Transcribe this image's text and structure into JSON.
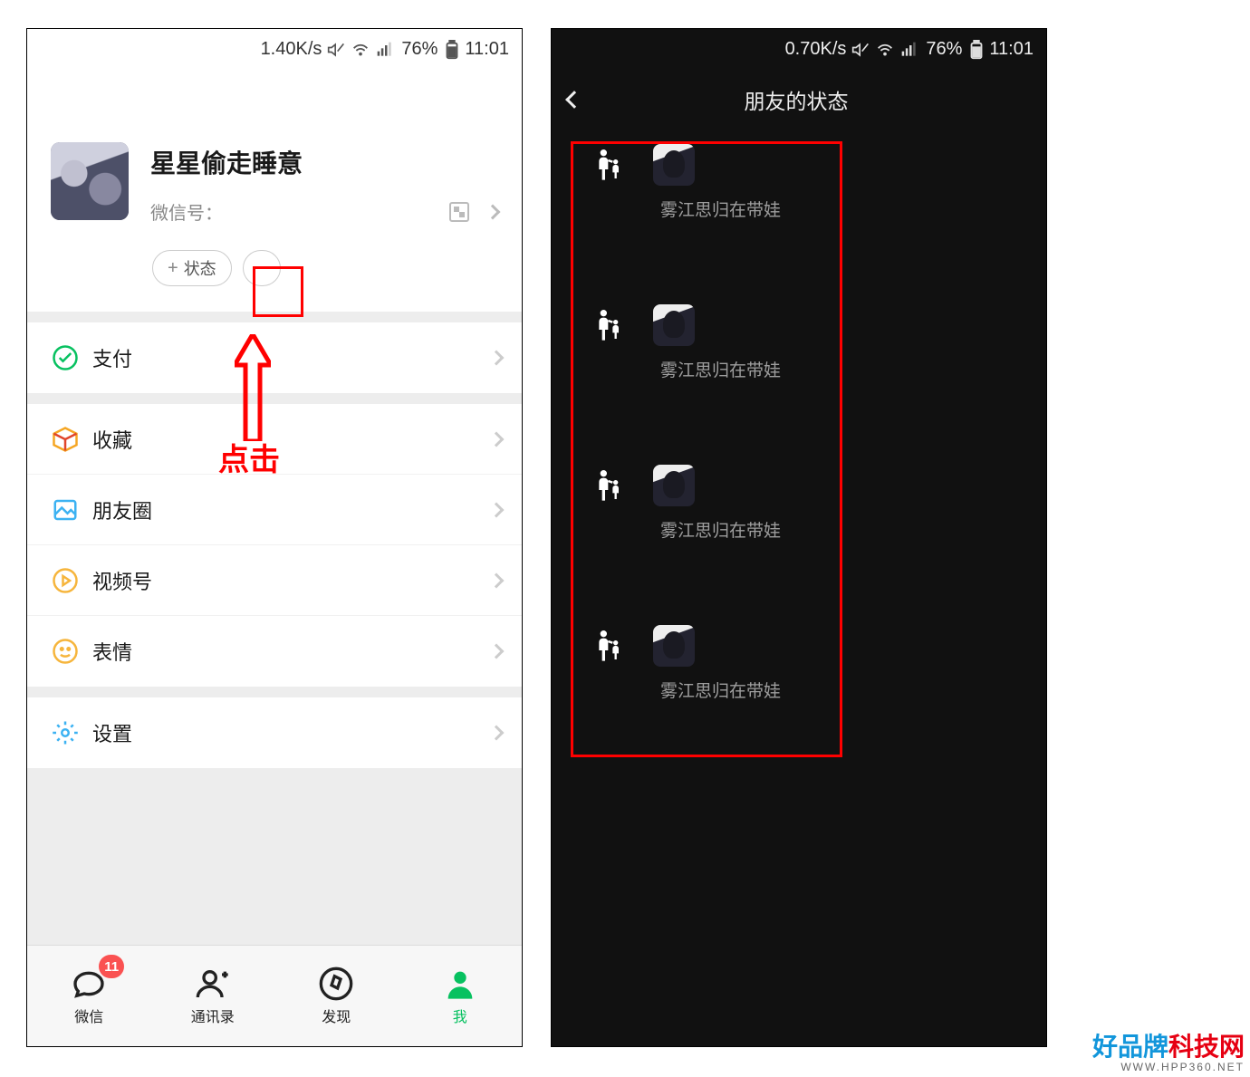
{
  "left": {
    "status": {
      "speed": "1.40K/s",
      "battery": "76%",
      "time": "11:01"
    },
    "profile": {
      "name": "星星偷走睡意",
      "wechat_id_label": "微信号：",
      "status_pill": "状态"
    },
    "annotation": {
      "click": "点击"
    },
    "menu": {
      "pay": "支付",
      "favorites": "收藏",
      "moments": "朋友圈",
      "channels": "视频号",
      "stickers": "表情",
      "settings": "设置"
    },
    "tabs": {
      "wechat": "微信",
      "contacts": "通讯录",
      "discover": "发现",
      "me": "我",
      "badge": "11"
    }
  },
  "right": {
    "status": {
      "speed": "0.70K/s",
      "battery": "76%",
      "time": "11:01"
    },
    "title": "朋友的状态",
    "friends": [
      {
        "text": "雾江思归在带娃"
      },
      {
        "text": "雾江思归在带娃"
      },
      {
        "text": "雾江思归在带娃"
      },
      {
        "text": "雾江思归在带娃"
      }
    ]
  },
  "watermark": {
    "line1a": "好品牌",
    "line1b": "科技网",
    "line2": "WWW.HPP360.NET"
  }
}
